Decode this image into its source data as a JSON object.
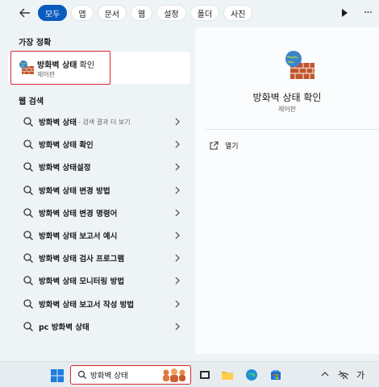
{
  "filters": [
    "모두",
    "앱",
    "문서",
    "웹",
    "설정",
    "폴더",
    "사진"
  ],
  "best_match": {
    "heading": "가장 정확",
    "title_bold": "방화벽 상태",
    "title_rest": " 확인",
    "subtitle": "제어판"
  },
  "web_search": {
    "heading": "웹 검색",
    "items": [
      {
        "text": "방화벽 상태",
        "suffix": "- 검색 결과 더 보기"
      },
      {
        "text": "방화벽 상태 확인",
        "suffix": ""
      },
      {
        "text": "방화벽 상태설정",
        "suffix": ""
      },
      {
        "text": "방화벽 상태 변경 방법",
        "suffix": ""
      },
      {
        "text": "방화벽 상태 변경 명령어",
        "suffix": ""
      },
      {
        "text": "방화벽 상태 보고서 예시",
        "suffix": ""
      },
      {
        "text": "방화벽 상태 검사 프로그램",
        "suffix": ""
      },
      {
        "text": "방화벽 상태 모니터링 방법",
        "suffix": ""
      },
      {
        "text": "방화벽 상태 보고서 작성 방법",
        "suffix": ""
      },
      {
        "text": "pc 방화벽 상태",
        "suffix": ""
      }
    ]
  },
  "detail": {
    "title": "방화벽 상태 확인",
    "subtitle": "제어판",
    "open_label": "열기"
  },
  "taskbar": {
    "search_value": "방화벽 상태",
    "ime_label": "가"
  },
  "colors": {
    "accent": "#0a5bbf",
    "highlight_border": "#d9262b"
  }
}
